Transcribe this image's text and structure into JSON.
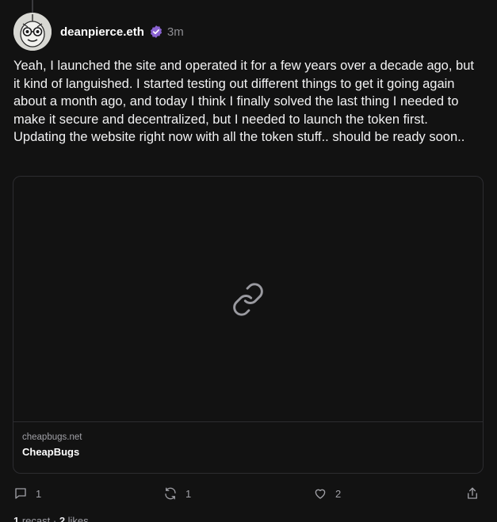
{
  "post": {
    "username": "deanpierce.eth",
    "verified_icon": "verified-badge-icon",
    "timestamp": "3m",
    "text": "Yeah, I launched the site and operated it for a few years over a decade ago, but it kind of languished. I started testing out different things to get it going again about a month ago, and today I think I finally solved the last thing I needed to make it secure and decentralized, but I needed to launch the token first.  Updating the website right now with all the token stuff.. should be ready soon..",
    "embed": {
      "placeholder_icon": "link-icon",
      "domain": "cheapbugs.net",
      "title": "CheapBugs"
    },
    "actions": {
      "reply_count": "1",
      "recast_count": "1",
      "like_count": "2"
    },
    "engagement": {
      "recasts_number": "1",
      "recasts_label": " recast",
      "separator": " · ",
      "likes_number": "2",
      "likes_label": " likes"
    }
  },
  "colors": {
    "background": "#121212",
    "accent_verified": "#8a63d2",
    "muted_text": "#8e8e93",
    "border": "#2c2c30"
  }
}
